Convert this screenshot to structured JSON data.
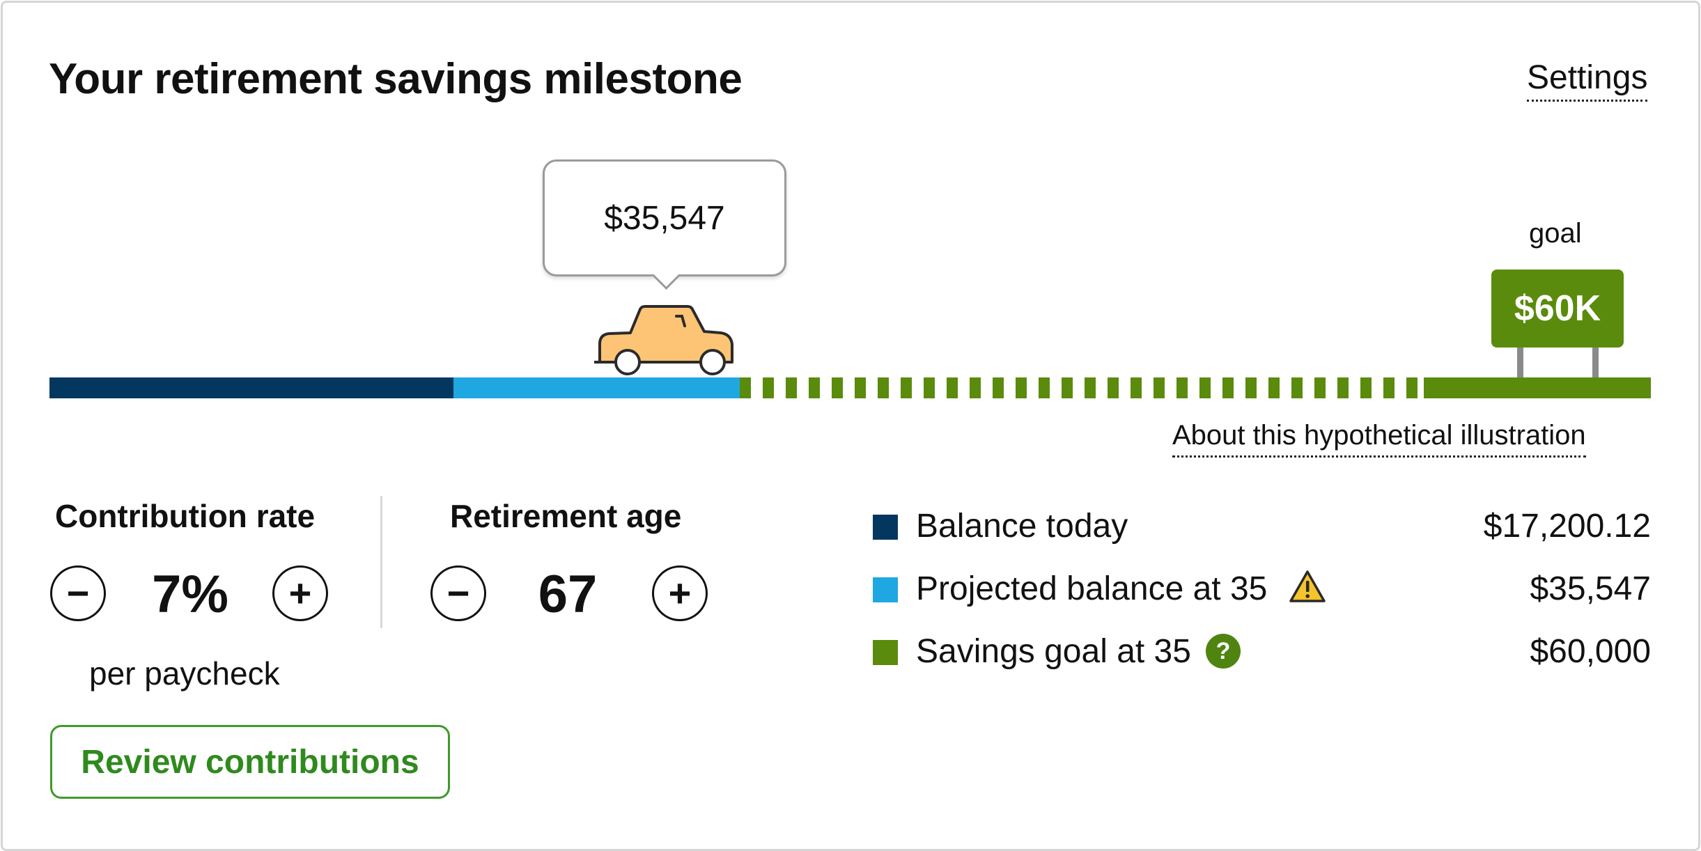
{
  "header": {
    "title": "Your retirement savings milestone",
    "settings_label": "Settings"
  },
  "milestone": {
    "tooltip_value": "$35,547",
    "goal_label": "goal",
    "goal_sign": "$60K",
    "about_link": "About this hypothetical illustration",
    "car_icon": "car-icon"
  },
  "contribution": {
    "title": "Contribution rate",
    "value": "7%",
    "unit": "per paycheck",
    "decrease_label": "−",
    "increase_label": "+"
  },
  "retirement": {
    "title": "Retirement age",
    "value": "67",
    "decrease_label": "−",
    "increase_label": "+"
  },
  "review_button": "Review contributions",
  "legend": [
    {
      "label": "Balance today",
      "value": "$17,200.12",
      "color": "#04375f"
    },
    {
      "label": "Projected balance at 35",
      "value": "$35,547",
      "color": "#1fa7e1",
      "icon": "warning-icon"
    },
    {
      "label": "Savings goal at 35",
      "value": "$60,000",
      "color": "#5a8b0c",
      "icon": "help-icon",
      "icon_text": "?"
    }
  ]
}
